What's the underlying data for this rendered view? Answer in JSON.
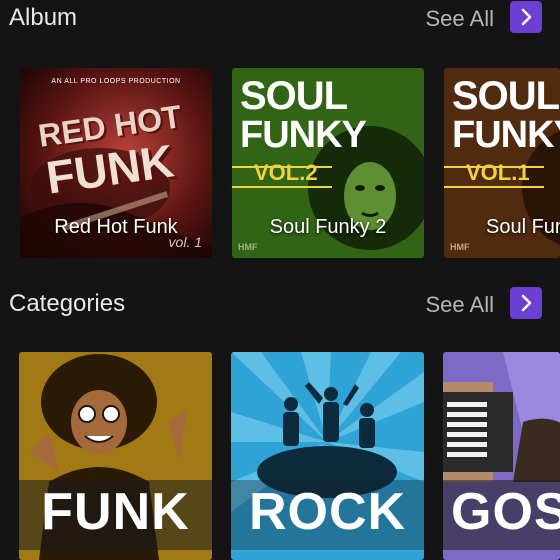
{
  "album_section": {
    "title": "Album",
    "see_all_label": "See All",
    "items": [
      {
        "label": "Red Hot Funk",
        "cover_line1": "RED HOT",
        "cover_line2": "FUNK",
        "cover_top": "AN ALL PRO LOOPS PRODUCTION",
        "cover_corner": "vol. 1"
      },
      {
        "label": "Soul Funky 2",
        "cover_line1": "SOUL",
        "cover_line2": "FUNKY",
        "cover_vol": "VOL.2",
        "cover_corner": "HMF"
      },
      {
        "label": "Soul Funky",
        "cover_line1": "SOUL",
        "cover_line2": "FUNKY",
        "cover_vol": "VOL.1",
        "cover_corner": "HMF"
      }
    ]
  },
  "categories_section": {
    "title": "Categories",
    "see_all_label": "See All",
    "items": [
      {
        "word": "FUNK"
      },
      {
        "word": "ROCK"
      },
      {
        "word": "GOSPEL"
      }
    ]
  },
  "colors": {
    "accent": "#6a3fd1",
    "background": "#141414",
    "funky_yellow": "#f2d33c"
  },
  "icons": {
    "see_all_arrow": "chevron-right-icon"
  }
}
